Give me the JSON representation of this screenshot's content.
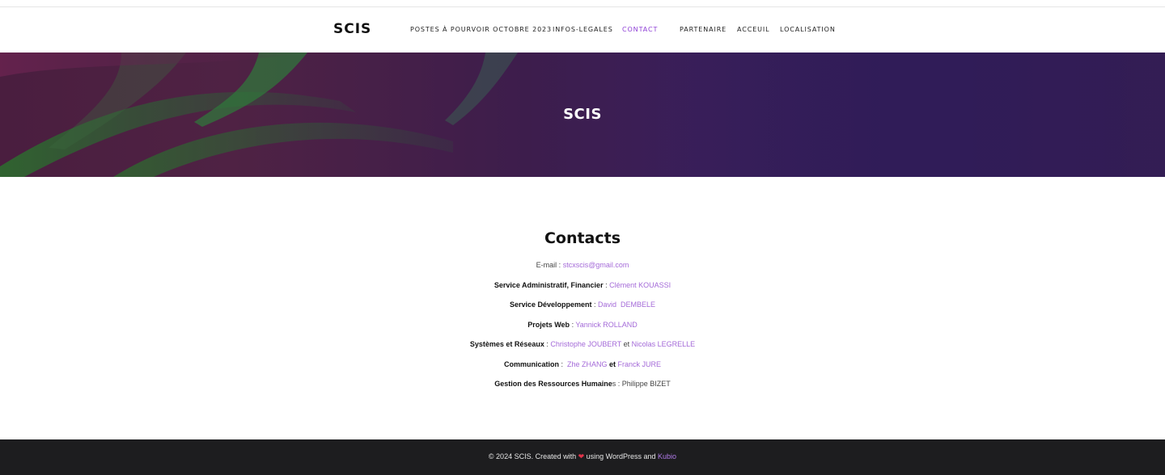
{
  "site": {
    "logo": "SCIS"
  },
  "nav": {
    "items": [
      {
        "label": "POSTES À POURVOIR OCTOBRE 2023"
      },
      {
        "label": "INFOS-LEGALES"
      },
      {
        "label": "CONTACT",
        "active": true
      },
      {
        "label": "PARTENAIRE"
      },
      {
        "label": "ACCEUIL"
      },
      {
        "label": "LOCALISATION"
      }
    ],
    "active_color": "#8e3fd6"
  },
  "hero": {
    "title": "SCIS"
  },
  "contacts": {
    "heading": "Contacts",
    "email": {
      "label": "E-mail",
      "sep": " : ",
      "value": "stcxscis@gmail.com"
    },
    "admin": {
      "label": "Service Administratif, Financier",
      "sep": " : ",
      "name": "Clément KOUASSI"
    },
    "dev": {
      "label": "Service Développement",
      "sep": " : ",
      "name": "David  DEMBELE"
    },
    "web": {
      "label": "Projets Web",
      "sep": " : ",
      "name": "Yannick ROLLAND"
    },
    "sys": {
      "label": "Systèmes et Réseaux",
      "sep": " : ",
      "name1": "Christophe JOUBERT",
      "and": " et ",
      "name2": "Nicolas LEGRELLE"
    },
    "comm": {
      "label": "Communication",
      "sep": " :  ",
      "name1": "Zhe ZHANG",
      "and": " et ",
      "name2": "Franck JURE"
    },
    "rh": {
      "label": "Gestion des Ressources Humaine",
      "suffix": "s : Philippe BIZET"
    },
    "link_color": "#a46ad8"
  },
  "footer": {
    "prefix": "© 2024 SCIS. Created with ",
    "heart": "❤",
    "middle": " using WordPress and ",
    "link": "Kubio"
  }
}
